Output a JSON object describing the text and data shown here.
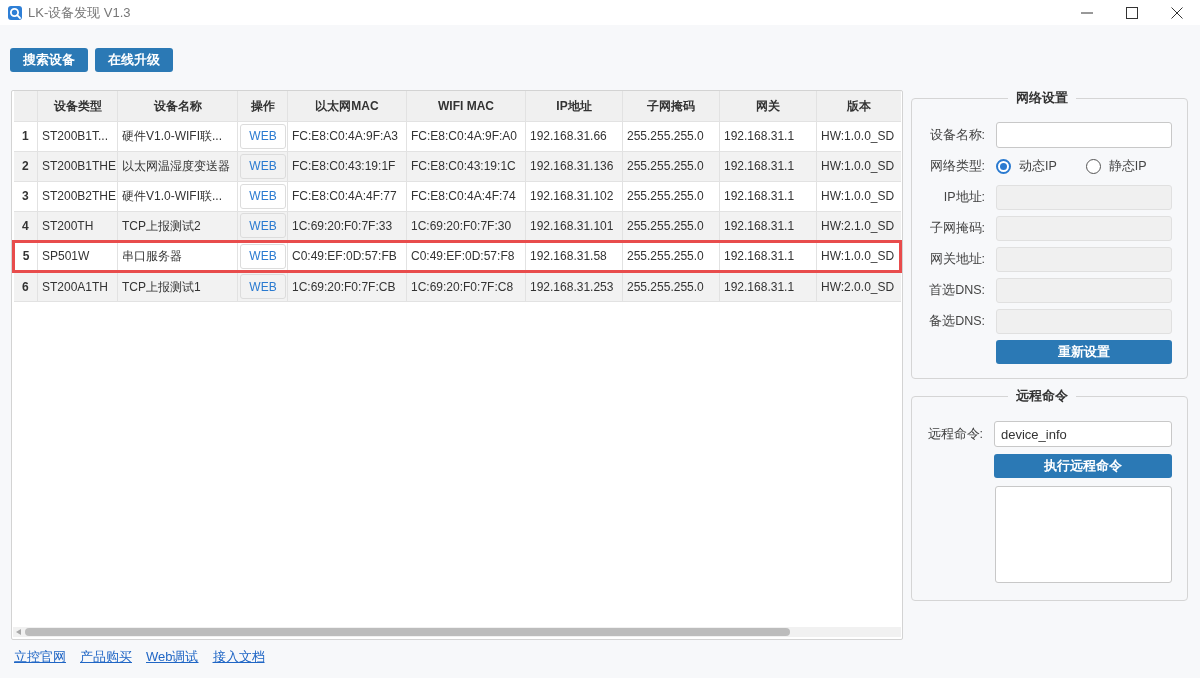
{
  "window": {
    "title": "LK-设备发现 V1.3"
  },
  "toolbar": {
    "buttons": [
      "搜索设备",
      "在线升级"
    ]
  },
  "device_table": {
    "columns": [
      "设备类型",
      "设备名称",
      "操作",
      "以太网MAC",
      "WIFI MAC",
      "IP地址",
      "子网掩码",
      "网关",
      "版本"
    ],
    "rows": [
      {
        "number": "1",
        "device_type": "ST200B1T...",
        "device_name": "硬件V1.0-WIFI联...",
        "action": "WEB",
        "ethernet_mac": "FC:E8:C0:4A:9F:A3",
        "wifi_mac": "FC:E8:C0:4A:9F:A0",
        "ip_address": "192.168.31.66",
        "subnet_mask": "255.255.255.0",
        "gateway": "192.168.31.1",
        "version": "HW:1.0.0_SD",
        "selected": false
      },
      {
        "number": "2",
        "device_type": "ST200B1THE",
        "device_name": "以太网温湿度变送器",
        "action": "WEB",
        "ethernet_mac": "FC:E8:C0:43:19:1F",
        "wifi_mac": "FC:E8:C0:43:19:1C",
        "ip_address": "192.168.31.136",
        "subnet_mask": "255.255.255.0",
        "gateway": "192.168.31.1",
        "version": "HW:1.0.0_SD",
        "selected": false
      },
      {
        "number": "3",
        "device_type": "ST200B2THE",
        "device_name": "硬件V1.0-WIFI联...",
        "action": "WEB",
        "ethernet_mac": "FC:E8:C0:4A:4F:77",
        "wifi_mac": "FC:E8:C0:4A:4F:74",
        "ip_address": "192.168.31.102",
        "subnet_mask": "255.255.255.0",
        "gateway": "192.168.31.1",
        "version": "HW:1.0.0_SD",
        "selected": false
      },
      {
        "number": "4",
        "device_type": "ST200TH",
        "device_name": "TCP上报测试2",
        "action": "WEB",
        "ethernet_mac": "1C:69:20:F0:7F:33",
        "wifi_mac": "1C:69:20:F0:7F:30",
        "ip_address": "192.168.31.101",
        "subnet_mask": "255.255.255.0",
        "gateway": "192.168.31.1",
        "version": "HW:2.1.0_SD",
        "selected": false
      },
      {
        "number": "5",
        "device_type": "SP501W",
        "device_name": "串口服务器",
        "action": "WEB",
        "ethernet_mac": "C0:49:EF:0D:57:FB",
        "wifi_mac": "C0:49:EF:0D:57:F8",
        "ip_address": "192.168.31.58",
        "subnet_mask": "255.255.255.0",
        "gateway": "192.168.31.1",
        "version": "HW:1.0.0_SD",
        "selected": true
      },
      {
        "number": "6",
        "device_type": "ST200A1TH",
        "device_name": "TCP上报测试1",
        "action": "WEB",
        "ethernet_mac": "1C:69:20:F0:7F:CB",
        "wifi_mac": "1C:69:20:F0:7F:C8",
        "ip_address": "192.168.31.253",
        "subnet_mask": "255.255.255.0",
        "gateway": "192.168.31.1",
        "version": "HW:2.0.0_SD",
        "selected": false
      }
    ]
  },
  "network_settings": {
    "title": "网络设置",
    "fields": [
      {
        "kind": "text",
        "label": "设备名称:",
        "disabled": false
      },
      {
        "kind": "radio",
        "label": "网络类型:",
        "options": [
          {
            "label": "动态IP",
            "selected": true
          },
          {
            "label": "静态IP",
            "selected": false
          }
        ]
      },
      {
        "kind": "text",
        "label": "IP地址:",
        "disabled": true
      },
      {
        "kind": "text",
        "label": "子网掩码:",
        "disabled": true
      },
      {
        "kind": "text",
        "label": "网关地址:",
        "disabled": true
      },
      {
        "kind": "text",
        "label": "首选DNS:",
        "disabled": true
      },
      {
        "kind": "text",
        "label": "备选DNS:",
        "disabled": true
      }
    ],
    "button": "重新设置"
  },
  "remote_command": {
    "title": "远程命令",
    "label": "远程命令:",
    "value": "device_info",
    "button": "执行远程命令"
  },
  "footer_links": [
    "立控官网",
    "产品购买",
    "Web调试",
    "接入文档"
  ]
}
